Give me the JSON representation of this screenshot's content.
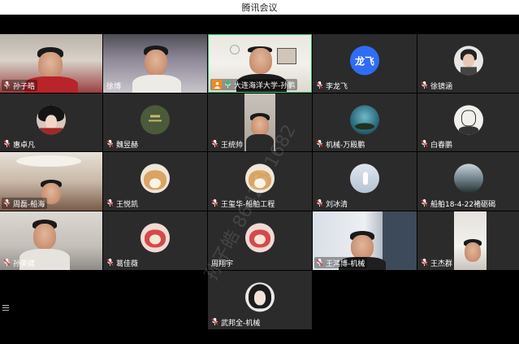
{
  "window": {
    "title": "腾讯会议"
  },
  "participants": [
    {
      "name": "孙子皓"
    },
    {
      "name": "徐博"
    },
    {
      "name": "大连海洋大学-孙鹏"
    },
    {
      "name": "李龙飞",
      "avatar_text": "龙飞"
    },
    {
      "name": "徐镜涵"
    },
    {
      "name": "惠卓凡"
    },
    {
      "name": "魏昱赫"
    },
    {
      "name": "王统帅"
    },
    {
      "name": "机械-万殿鹏"
    },
    {
      "name": "白春鹏"
    },
    {
      "name": "周磊-船海"
    },
    {
      "name": "王悦凯"
    },
    {
      "name": "王玺华-船舶工程"
    },
    {
      "name": "刘冰清"
    },
    {
      "name": "船舶18-4-22褚砺碣"
    },
    {
      "name": "孙英健"
    },
    {
      "name": "葛佳薇"
    },
    {
      "name": "周翔宇"
    },
    {
      "name": "王鸿博-机械"
    },
    {
      "name": "王杰群"
    },
    {
      "name": "武邦全-机械"
    }
  ],
  "watermark": "孙子皓 8642651682",
  "colors": {
    "tile_bg": "#2b2b2b",
    "speaking_border": "#37c06a",
    "host_badge": "#f08a1c",
    "avatar_blue": "#2f6df6"
  }
}
